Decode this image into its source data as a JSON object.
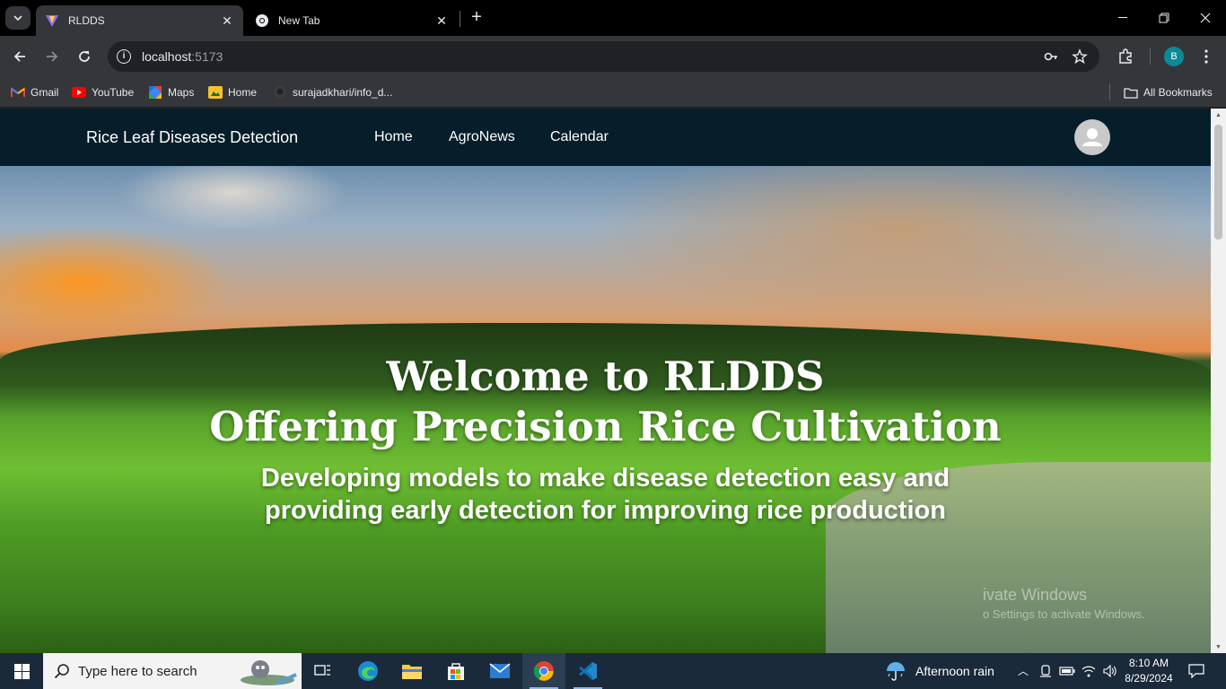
{
  "browser": {
    "tabs": [
      {
        "title": "RLDDS",
        "active": true,
        "icon": "vite-logo-icon"
      },
      {
        "title": "New Tab",
        "active": false,
        "icon": "chrome-logo-icon"
      }
    ],
    "address": {
      "host": "localhost",
      "port": ":5173"
    },
    "profile_initial": "B",
    "bookmarks": [
      {
        "label": "Gmail",
        "icon": "gmail-icon"
      },
      {
        "label": "YouTube",
        "icon": "youtube-icon"
      },
      {
        "label": "Maps",
        "icon": "maps-icon"
      },
      {
        "label": "Home",
        "icon": "home-bookmark-icon"
      },
      {
        "label": "surajadkhari/info_d...",
        "icon": "github-icon"
      }
    ],
    "all_bookmarks": "All Bookmarks"
  },
  "site": {
    "brand": "Rice Leaf Diseases Detection",
    "nav": [
      "Home",
      "AgroNews",
      "Calendar"
    ],
    "hero": {
      "line1": "Welcome to RLDDS",
      "line2": "Offering Precision Rice Cultivation",
      "line3a": "Developing models to make disease detection easy and",
      "line3b": "providing early detection for improving rice production"
    },
    "watermark": {
      "title": "ivate Windows",
      "sub": "o Settings to activate Windows."
    }
  },
  "taskbar": {
    "search_placeholder": "Type here to search",
    "weather": "Afternoon rain",
    "time": "8:10 AM",
    "date": "8/29/2024"
  }
}
